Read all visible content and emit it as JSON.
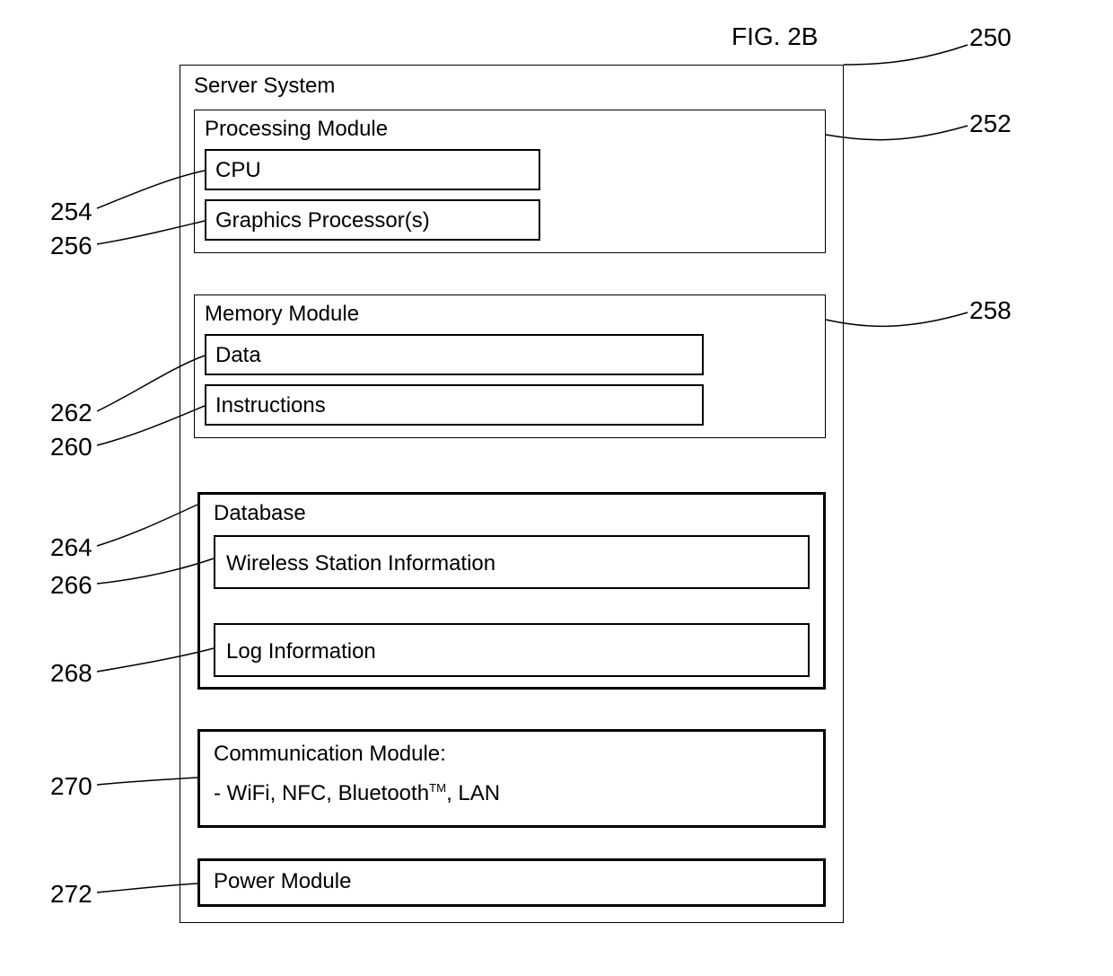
{
  "figure_title": "FIG. 2B",
  "server_system": {
    "title": "Server System",
    "ref": "250",
    "processing_module": {
      "title": "Processing Module",
      "ref": "252",
      "cpu": {
        "label": "CPU",
        "ref": "254"
      },
      "graphics": {
        "label": "Graphics Processor(s)",
        "ref": "256"
      }
    },
    "memory_module": {
      "title": "Memory Module",
      "ref": "258",
      "data": {
        "label": "Data",
        "ref": "262"
      },
      "instructions": {
        "label": "Instructions",
        "ref": "260"
      }
    },
    "database": {
      "title": "Database",
      "ref": "264",
      "wireless": {
        "label": "Wireless Station Information",
        "ref": "266"
      },
      "log": {
        "label": "Log Information",
        "ref": "268"
      }
    },
    "communication_module": {
      "title": "Communication Module:",
      "protocols": "- WiFi, NFC, Bluetooth",
      "tm": "TM",
      "protocols_suffix": ", LAN",
      "ref": "270"
    },
    "power_module": {
      "title": "Power Module",
      "ref": "272"
    }
  }
}
